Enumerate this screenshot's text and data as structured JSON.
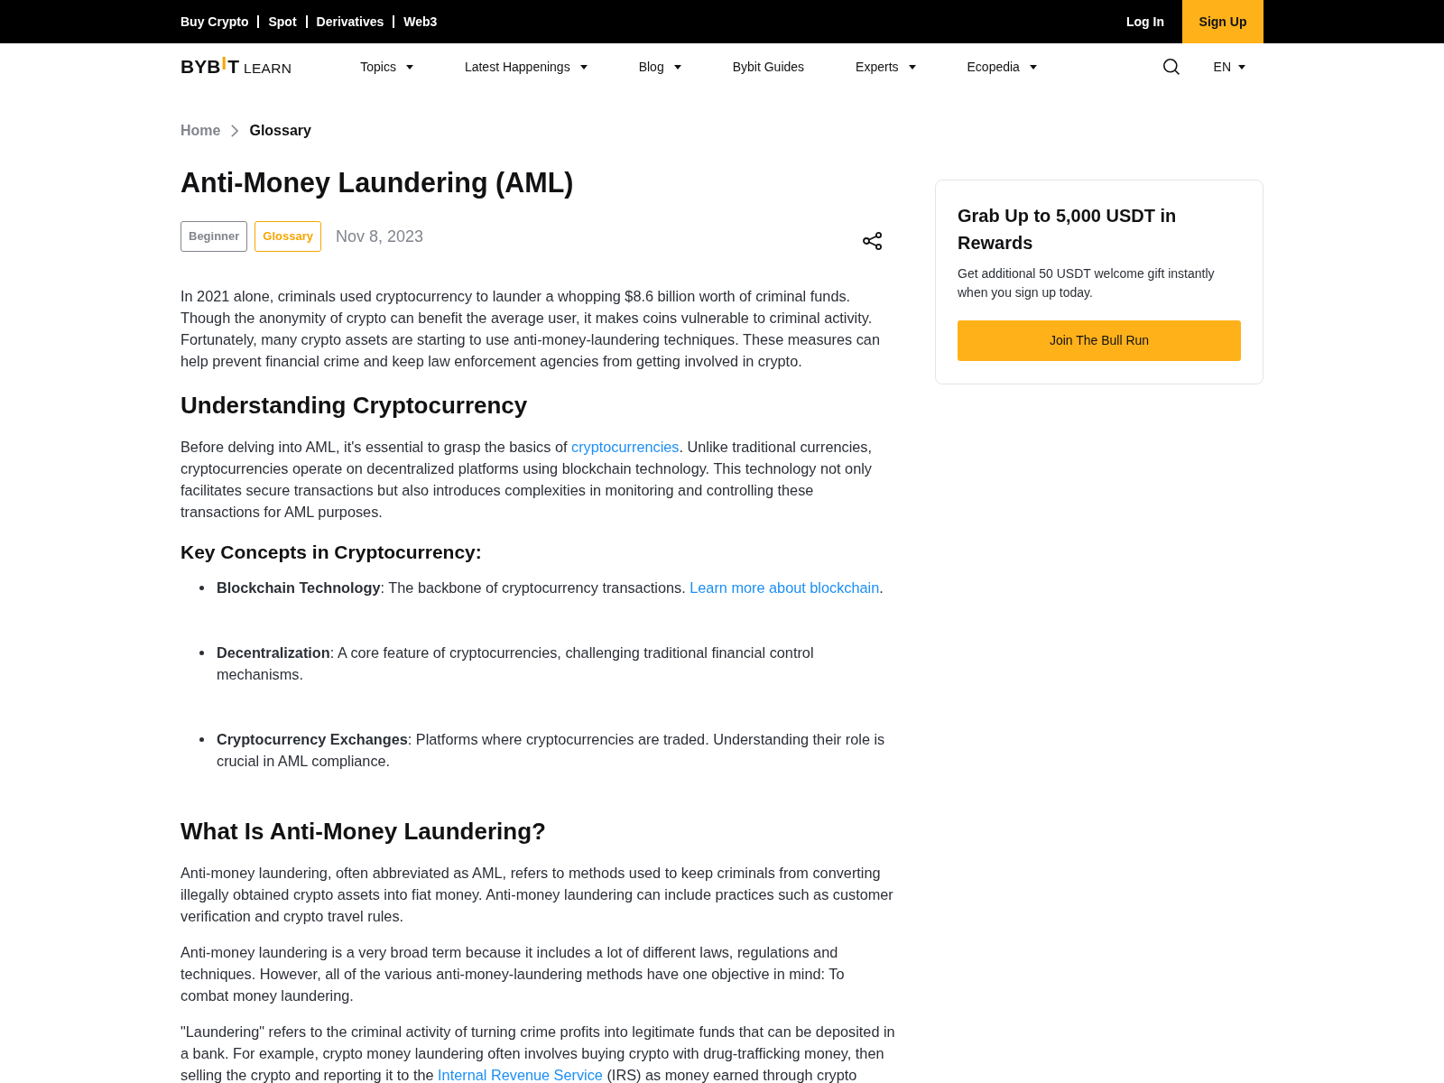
{
  "top_bar": {
    "links": [
      "Buy Crypto",
      "Spot",
      "Derivatives",
      "Web3"
    ],
    "login": "Log In",
    "signup": "Sign Up"
  },
  "nav": {
    "logo": {
      "parts": [
        {
          "text": "BYB",
          "accent": false
        },
        {
          "text": "I",
          "accent": true
        },
        {
          "text": "T",
          "accent": false
        }
      ],
      "suffix": "LEARN"
    },
    "items": [
      {
        "label": "Topics",
        "dropdown": true
      },
      {
        "label": "Latest Happenings",
        "dropdown": true
      },
      {
        "label": "Blog",
        "dropdown": true
      },
      {
        "label": "Bybit Guides",
        "dropdown": false
      },
      {
        "label": "Experts",
        "dropdown": true
      },
      {
        "label": "Ecopedia",
        "dropdown": true
      }
    ],
    "language": "EN"
  },
  "breadcrumb": [
    {
      "label": "Home",
      "current": false
    },
    {
      "label": "Glossary",
      "current": true
    }
  ],
  "article": {
    "title": "Anti-Money Laundering (AML)",
    "tags": [
      {
        "label": "Beginner",
        "color": "#81858c"
      },
      {
        "label": "Glossary",
        "color": "#f7a600"
      }
    ],
    "date": "Nov 8, 2023",
    "blocks": [
      {
        "kind": "paragraph",
        "segments": [
          {
            "kind": "text",
            "text": "In 2021 alone, criminals used cryptocurrency to launder a whopping $8.6 billion worth of criminal funds. Though the anonymity of crypto can benefit the average user, it makes coins vulnerable to criminal activity. Fortunately, many crypto assets are starting to use anti-money-laundering techniques. These measures can help prevent financial crime and keep law enforcement agencies from getting involved in crypto."
          }
        ]
      },
      {
        "kind": "heading",
        "text": "Understanding Cryptocurrency"
      },
      {
        "kind": "paragraph",
        "segments": [
          {
            "kind": "text",
            "text": "Before delving into AML, it's essential to grasp the basics of "
          },
          {
            "kind": "link",
            "text": "cryptocurrencies"
          },
          {
            "kind": "text",
            "text": ". Unlike traditional currencies, cryptocurrencies operate on decentralized platforms using blockchain technology. This technology not only facilitates secure transactions but also introduces complexities in monitoring and controlling these transactions for AML purposes."
          }
        ]
      },
      {
        "kind": "subheading",
        "text": "Key Concepts in Cryptocurrency:"
      },
      {
        "kind": "list",
        "items": [
          {
            "segments": [
              {
                "kind": "text",
                "text": "**Blockchain Technology**: The backbone of cryptocurrency transactions. "
              },
              {
                "kind": "link",
                "text": "Learn more about blockchain"
              },
              {
                "kind": "text",
                "text": "."
              }
            ]
          },
          {
            "segments": [
              {
                "kind": "text",
                "text": "**Decentralization**: A core feature of cryptocurrencies, challenging traditional financial control mechanisms."
              }
            ]
          },
          {
            "segments": [
              {
                "kind": "text",
                "text": "**Cryptocurrency Exchanges**: Platforms where cryptocurrencies are traded. Understanding their role is crucial in AML compliance."
              }
            ]
          }
        ]
      },
      {
        "kind": "heading",
        "text": "What Is Anti-Money Laundering?"
      },
      {
        "kind": "paragraph",
        "segments": [
          {
            "kind": "text",
            "text": "Anti-money laundering, often abbreviated as AML, refers to methods used to keep criminals from converting illegally obtained crypto assets into fiat money. Anti-money laundering can include practices such as customer verification and crypto travel rules."
          }
        ]
      },
      {
        "kind": "paragraph",
        "segments": [
          {
            "kind": "text",
            "text": "Anti-money laundering is a very broad term because it includes a lot of different laws, regulations and techniques. However, all of the various anti-money-laundering methods have one objective in mind: To combat money laundering."
          }
        ]
      },
      {
        "kind": "paragraph",
        "segments": [
          {
            "kind": "text",
            "text": "\"Laundering\" refers to the criminal activity of turning crime profits into legitimate funds that can be deposited in a bank. For example, crypto money laundering often involves buying crypto with drug-trafficking money, then selling the crypto and reporting it to the "
          },
          {
            "kind": "link",
            "text": "Internal Revenue Service"
          },
          {
            "kind": "text",
            "text": " (IRS) as money earned through crypto"
          }
        ]
      }
    ]
  },
  "promo": {
    "title": "Grab Up to 5,000 USDT in Rewards",
    "text": "Get additional 50 USDT welcome gift instantly when you sign up today.",
    "button": "Join The Bull Run"
  }
}
